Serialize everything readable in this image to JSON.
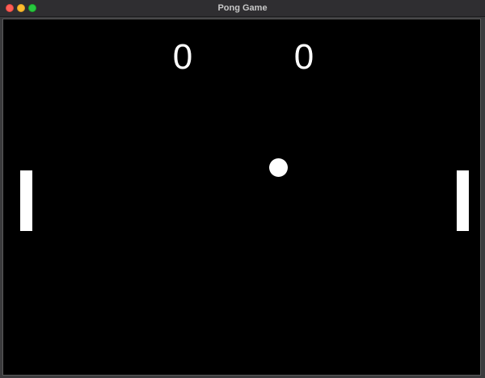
{
  "window": {
    "title": "Pong Game"
  },
  "game": {
    "score_left": "0",
    "score_right": "0"
  },
  "colors": {
    "court": "#000000",
    "foreground": "#ffffff",
    "close_button": "#ff5f57",
    "minimize_button": "#febc2e",
    "maximize_button": "#28c840"
  },
  "icons": {
    "close": "close-icon",
    "minimize": "minimize-icon",
    "maximize": "maximize-icon"
  }
}
